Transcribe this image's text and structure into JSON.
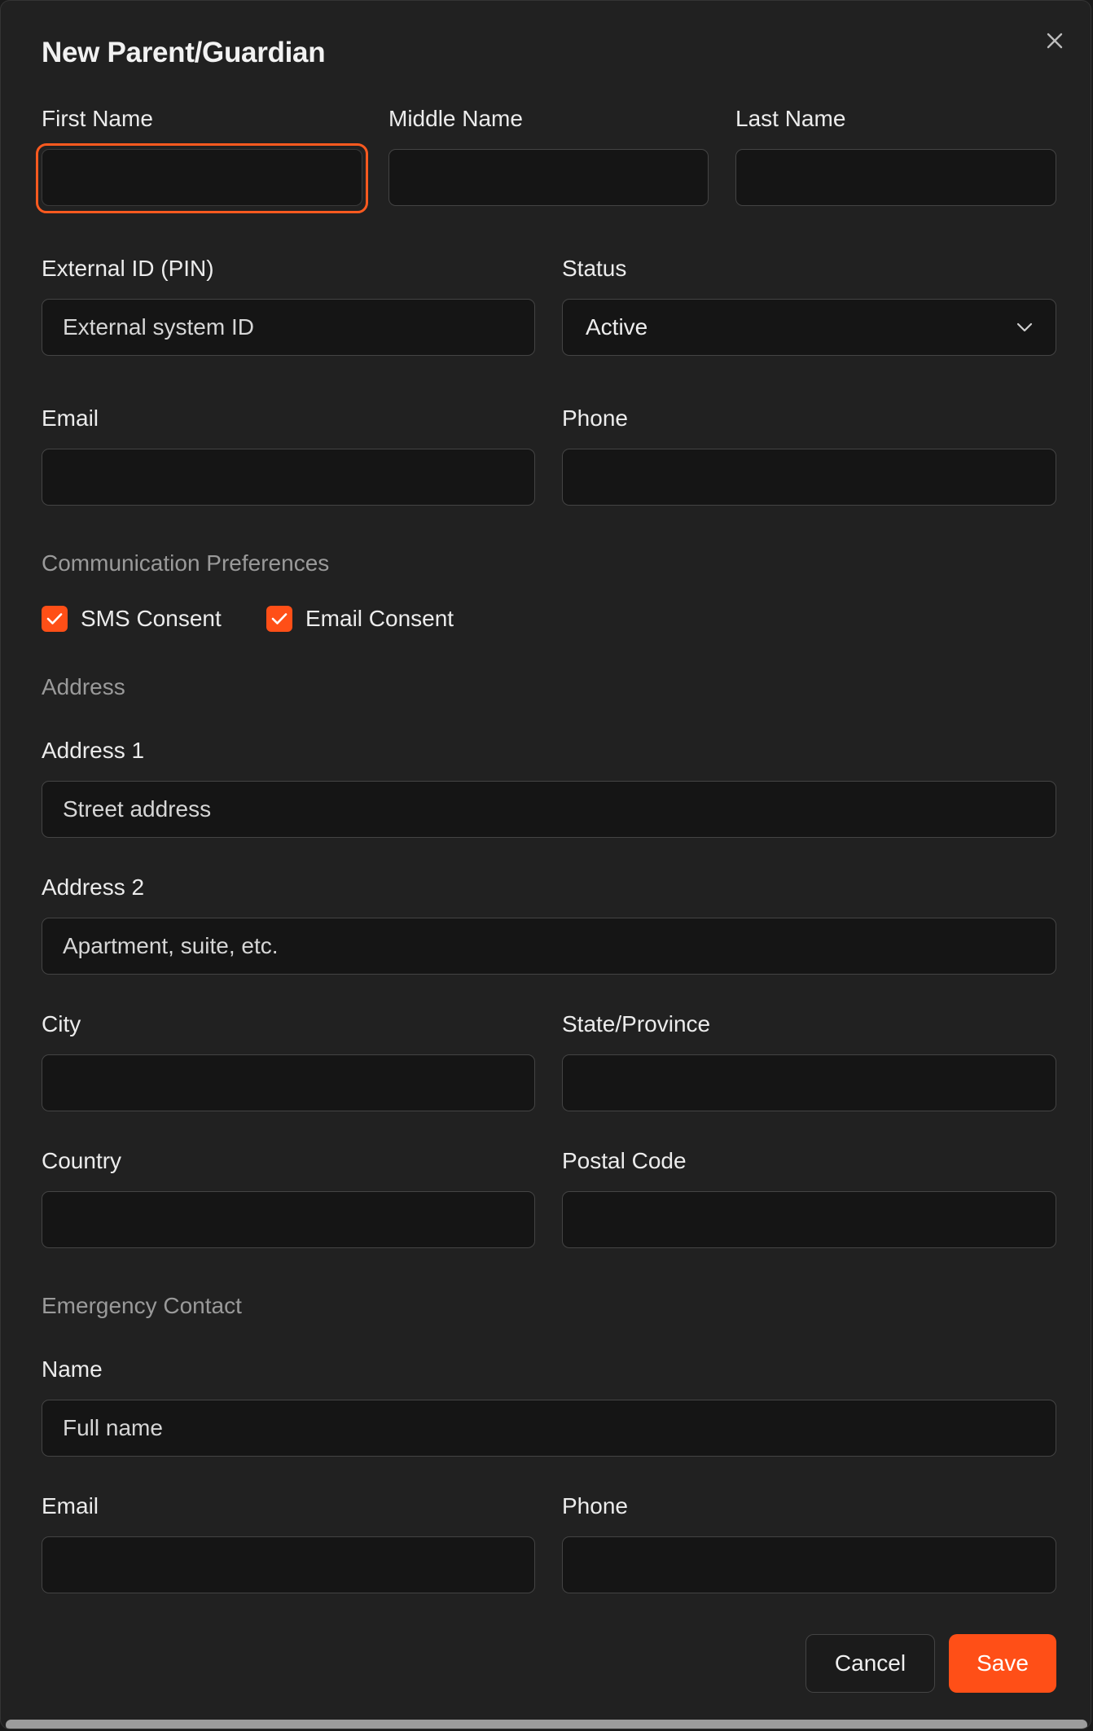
{
  "dialog": {
    "title": "New Parent/Guardian",
    "close_icon": "close-icon"
  },
  "fields": {
    "first_name": {
      "label": "First Name",
      "value": "",
      "placeholder": ""
    },
    "middle_name": {
      "label": "Middle Name",
      "value": "",
      "placeholder": ""
    },
    "last_name": {
      "label": "Last Name",
      "value": "",
      "placeholder": ""
    },
    "external_id": {
      "label": "External ID (PIN)",
      "value": "",
      "placeholder": "External system ID"
    },
    "status": {
      "label": "Status",
      "selected": "Active",
      "icon": "chevron-down-icon"
    },
    "email": {
      "label": "Email",
      "value": "",
      "placeholder": ""
    },
    "phone": {
      "label": "Phone",
      "value": "",
      "placeholder": ""
    }
  },
  "communication": {
    "heading": "Communication Preferences",
    "sms_consent": {
      "label": "SMS Consent",
      "checked": true
    },
    "email_consent": {
      "label": "Email Consent",
      "checked": true
    }
  },
  "address": {
    "heading": "Address",
    "address1": {
      "label": "Address 1",
      "value": "",
      "placeholder": "Street address"
    },
    "address2": {
      "label": "Address 2",
      "value": "",
      "placeholder": "Apartment, suite, etc."
    },
    "city": {
      "label": "City",
      "value": "",
      "placeholder": ""
    },
    "state": {
      "label": "State/Province",
      "value": "",
      "placeholder": ""
    },
    "country": {
      "label": "Country",
      "value": "",
      "placeholder": ""
    },
    "postal_code": {
      "label": "Postal Code",
      "value": "",
      "placeholder": ""
    }
  },
  "emergency": {
    "heading": "Emergency Contact",
    "name": {
      "label": "Name",
      "value": "",
      "placeholder": "Full name"
    },
    "email": {
      "label": "Email",
      "value": "",
      "placeholder": ""
    },
    "phone": {
      "label": "Phone",
      "value": "",
      "placeholder": ""
    }
  },
  "actions": {
    "cancel_label": "Cancel",
    "save_label": "Save"
  },
  "colors": {
    "accent": "#ff4f17",
    "background": "#212121",
    "input_background": "#151515"
  }
}
